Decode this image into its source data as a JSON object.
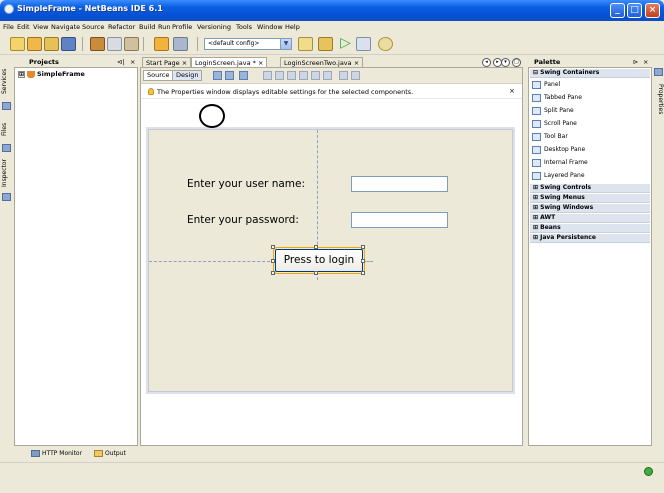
{
  "window": {
    "title": "SimpleFrame - NetBeans IDE 6.1"
  },
  "menu": [
    "File",
    "Edit",
    "View",
    "Navigate",
    "Source",
    "Refactor",
    "Build",
    "Run",
    "Profile",
    "Versioning",
    "Tools",
    "Window",
    "Help"
  ],
  "toolbar": {
    "config_value": "<default config>"
  },
  "left_strip": {
    "tabs": [
      "Services",
      "Files",
      "Inspector"
    ]
  },
  "projects": {
    "title": "Projects",
    "pin": "⊲|",
    "close": "×",
    "tree": [
      {
        "label": "SimpleFrame",
        "expander": "⊞"
      }
    ]
  },
  "bottom_tabs": [
    "HTTP Monitor",
    "Output"
  ],
  "editor": {
    "tabs": [
      {
        "label": "Start Page",
        "close": "×",
        "active": false
      },
      {
        "label": "LoginScreen.java *",
        "close": "×",
        "active": true
      },
      {
        "label": "LoginScreenTwo.java",
        "close": "×",
        "active": false
      }
    ],
    "view_buttons": [
      "Source",
      "Design"
    ],
    "info_message": "The Properties window displays editable settings for the selected components.",
    "info_close": "×"
  },
  "form": {
    "username_label": "Enter your user name:",
    "password_label": "Enter your password:",
    "login_button": "Press to login"
  },
  "palette": {
    "title": "Palette",
    "pin": "⊳",
    "close": "×",
    "categories": [
      {
        "label": "⊟ Swing Containers",
        "expanded": true
      },
      {
        "label": "⊞ Swing Controls",
        "expanded": false
      },
      {
        "label": "⊞ Swing Menus",
        "expanded": false
      },
      {
        "label": "⊞ Swing Windows",
        "expanded": false
      },
      {
        "label": "⊞ AWT",
        "expanded": false
      },
      {
        "label": "⊞ Beans",
        "expanded": false
      },
      {
        "label": "⊞ Java Persistence",
        "expanded": false
      }
    ],
    "items": [
      "Panel",
      "Tabbed Pane",
      "Split Pane",
      "Scroll Pane",
      "Tool Bar",
      "Desktop Pane",
      "Internal Frame",
      "Layered Pane"
    ]
  },
  "right_strip": {
    "tab": "Properties"
  }
}
